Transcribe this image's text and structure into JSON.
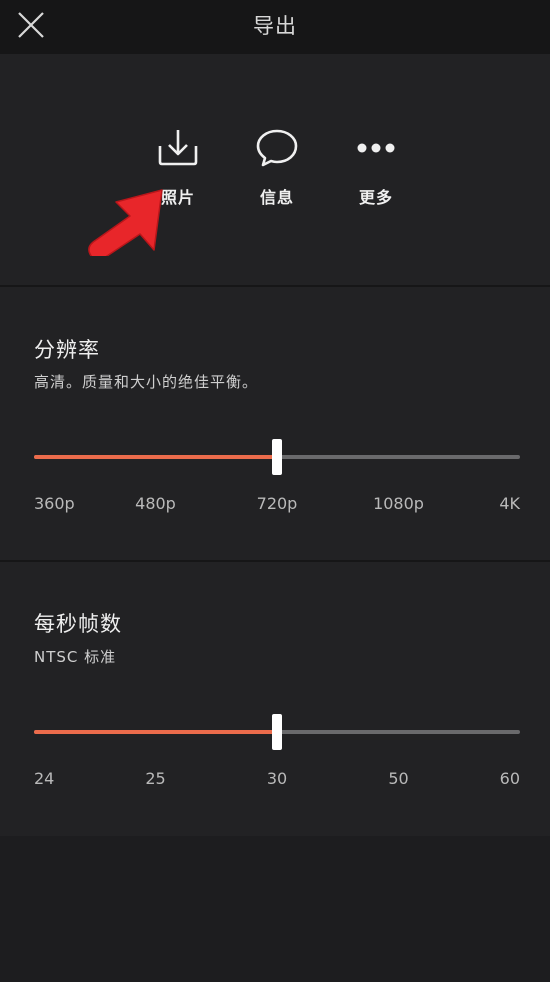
{
  "header": {
    "title": "导出",
    "close_icon": "close-icon"
  },
  "share": [
    {
      "label": "照片",
      "icon": "download-icon"
    },
    {
      "label": "信息",
      "icon": "message-bubble-icon"
    },
    {
      "label": "更多",
      "icon": "more-dots-icon"
    }
  ],
  "resolution": {
    "title": "分辨率",
    "subtitle": "高清。质量和大小的绝佳平衡。",
    "options": [
      "360p",
      "480p",
      "720p",
      "1080p",
      "4K"
    ],
    "selected": "720p",
    "selected_index": 2
  },
  "framerate": {
    "title": "每秒帧数",
    "subtitle": "NTSC 标准",
    "options": [
      "24",
      "25",
      "30",
      "50",
      "60"
    ],
    "selected": "30",
    "selected_index": 2
  },
  "colors": {
    "accent": "#ec6c4c",
    "track": "#6a6a6c",
    "arrow": "#e8262a",
    "background": "#222224"
  }
}
